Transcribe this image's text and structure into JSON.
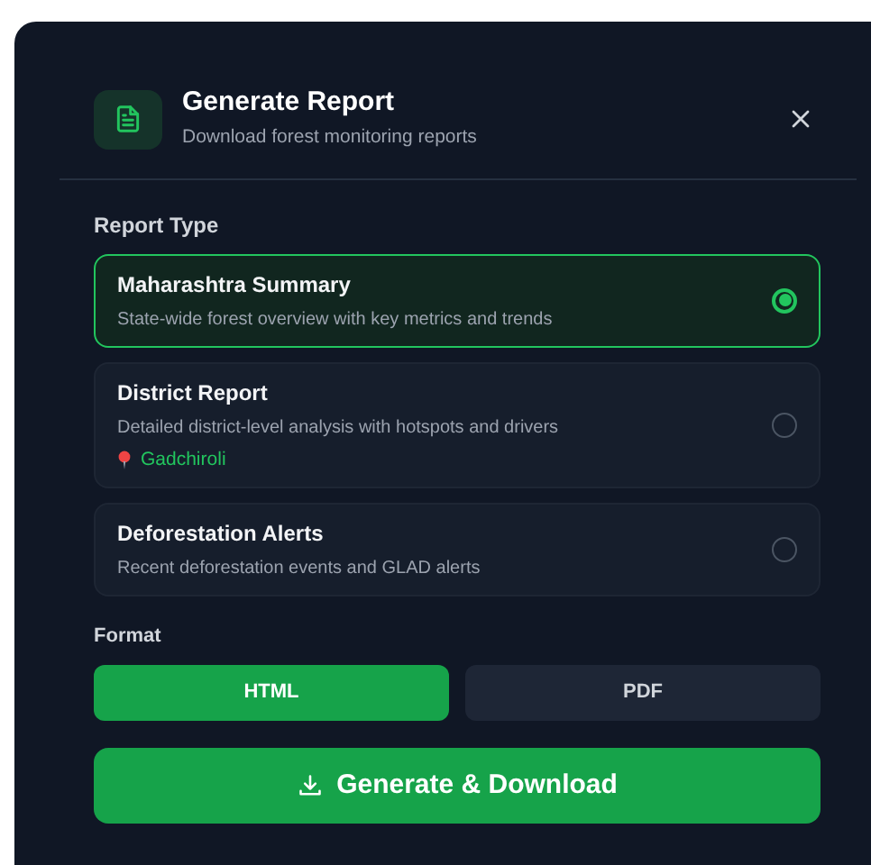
{
  "dialog": {
    "title": "Generate Report",
    "subtitle": "Download forest monitoring reports"
  },
  "report_type": {
    "label": "Report Type",
    "options": [
      {
        "title": "Maharashtra Summary",
        "description": "State-wide forest overview with key metrics and trends",
        "selected": true
      },
      {
        "title": "District Report",
        "description": "Detailed district-level analysis with hotspots and drivers",
        "location": "Gadchiroli",
        "selected": false
      },
      {
        "title": "Deforestation Alerts",
        "description": "Recent deforestation events and GLAD alerts",
        "selected": false
      }
    ]
  },
  "format": {
    "label": "Format",
    "options": [
      {
        "label": "HTML",
        "selected": true
      },
      {
        "label": "PDF",
        "selected": false
      }
    ]
  },
  "action_button": "Generate & Download"
}
